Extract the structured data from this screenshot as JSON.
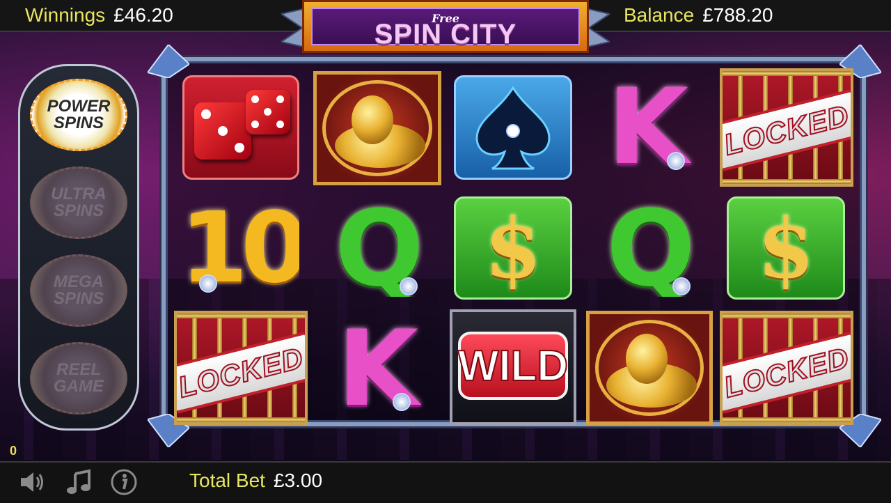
{
  "header": {
    "winnings_label": "Winnings",
    "winnings_value": "£46.20",
    "balance_label": "Balance",
    "balance_value": "£788.20"
  },
  "logo": {
    "free": "Free",
    "title": "SPIN CITY"
  },
  "features": [
    {
      "label": "POWER SPINS",
      "active": true
    },
    {
      "label": "ULTRA SPINS",
      "active": false
    },
    {
      "label": "MEGA SPINS",
      "active": false
    },
    {
      "label": "REEL GAME",
      "active": false
    }
  ],
  "feature_counter": "0",
  "reels": [
    [
      "dice",
      "coins",
      "spade",
      "K",
      "LOCKED"
    ],
    [
      "10",
      "Q",
      "$",
      "Q",
      "$"
    ],
    [
      "LOCKED",
      "K",
      "WILD",
      "coins",
      "LOCKED"
    ]
  ],
  "symbols": {
    "locked": "LOCKED",
    "wild": "WILD",
    "dollar": "$",
    "king": "K",
    "queen": "Q",
    "ten": "10"
  },
  "footer": {
    "total_bet_label": "Total Bet",
    "total_bet_value": "£3.00"
  },
  "icons": [
    "speaker-icon",
    "music-note-icon",
    "info-icon"
  ]
}
